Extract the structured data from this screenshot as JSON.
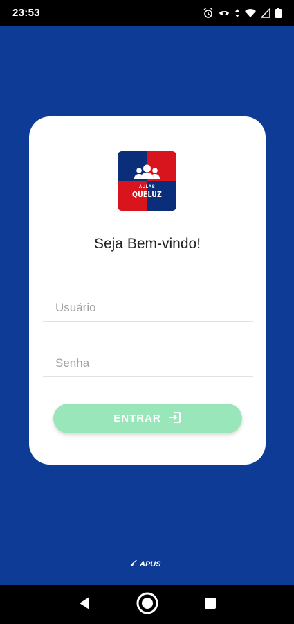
{
  "status_bar": {
    "time": "23:53",
    "icons": [
      "alarm-icon",
      "eye-icon",
      "data-arrows-icon",
      "wifi-icon",
      "signal-icon",
      "battery-icon"
    ]
  },
  "logo": {
    "text_top": "AULAS",
    "text_main": "QUELUZ",
    "colors": {
      "blue": "#0b2e7a",
      "red": "#d8141c"
    }
  },
  "welcome": "Seja Bem-vindo!",
  "form": {
    "username_placeholder": "Usuário",
    "username_value": "",
    "password_placeholder": "Senha",
    "password_value": ""
  },
  "enter_button": {
    "label": "ENTRAR",
    "icon": "login-icon"
  },
  "footer": {
    "brand": "APUS"
  },
  "nav_bar": {
    "items": [
      "back-icon",
      "home-icon",
      "recents-icon"
    ]
  },
  "colors": {
    "background": "#0d3b96",
    "card": "#ffffff",
    "button": "#9ae6bb"
  }
}
